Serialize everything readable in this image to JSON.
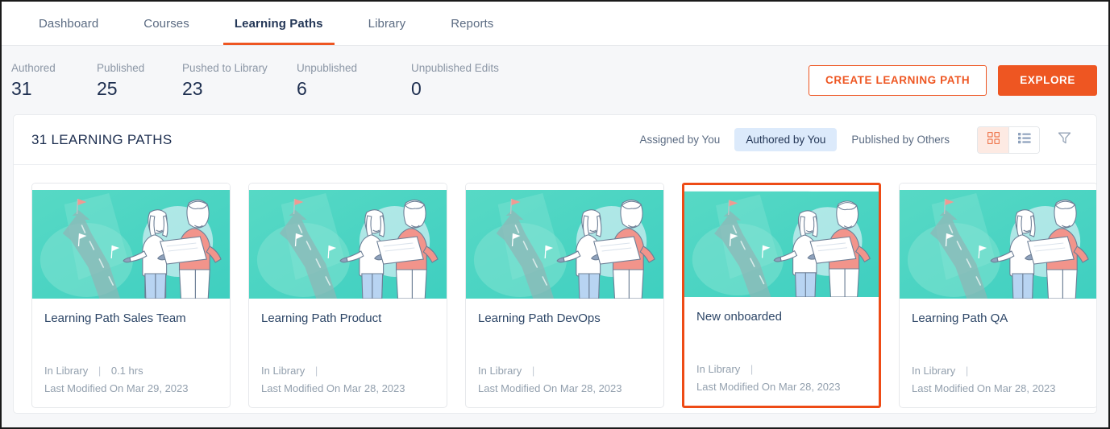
{
  "nav": {
    "tabs": [
      {
        "label": "Dashboard",
        "active": false
      },
      {
        "label": "Courses",
        "active": false
      },
      {
        "label": "Learning Paths",
        "active": true
      },
      {
        "label": "Library",
        "active": false
      },
      {
        "label": "Reports",
        "active": false
      }
    ]
  },
  "stats": [
    {
      "label": "Authored",
      "value": "31"
    },
    {
      "label": "Published",
      "value": "25"
    },
    {
      "label": "Pushed to Library",
      "value": "23"
    },
    {
      "label": "Unpublished",
      "value": "6"
    },
    {
      "label": "Unpublished Edits",
      "value": "0"
    }
  ],
  "actions": {
    "create_label": "CREATE LEARNING PATH",
    "explore_label": "EXPLORE"
  },
  "panel": {
    "title": "31 LEARNING PATHS",
    "segments": [
      {
        "label": "Assigned by You",
        "active": false
      },
      {
        "label": "Authored by You",
        "active": true
      },
      {
        "label": "Published by Others",
        "active": false
      }
    ],
    "view_modes": [
      {
        "name": "grid-view",
        "active": true
      },
      {
        "name": "list-view",
        "active": false
      }
    ],
    "filter_icon": "funnel-icon"
  },
  "cards": [
    {
      "title": "Learning Path Sales Team",
      "status": "In Library",
      "duration": "0.1 hrs",
      "modified": "Last Modified On Mar 29, 2023",
      "selected": false
    },
    {
      "title": "Learning Path Product",
      "status": "In Library",
      "duration": "",
      "modified": "Last Modified On Mar 28, 2023",
      "selected": false
    },
    {
      "title": "Learning Path DevOps",
      "status": "In Library",
      "duration": "",
      "modified": "Last Modified On Mar 28, 2023",
      "selected": false
    },
    {
      "title": "New onboarded",
      "status": "In Library",
      "duration": "",
      "modified": "Last Modified On Mar 28, 2023",
      "selected": true
    },
    {
      "title": "Learning Path QA",
      "status": "In Library",
      "duration": "",
      "modified": "Last Modified On Mar 28, 2023",
      "selected": false
    }
  ],
  "colors": {
    "accent_orange": "#ee5622",
    "selected_border": "#ee4b16",
    "active_pill_bg": "#dceafb",
    "title_navy": "#1d2e4f",
    "muted_text": "#8b96a5",
    "illustration_teal": "#4ed6c2",
    "illustration_coral": "#f08a80"
  }
}
